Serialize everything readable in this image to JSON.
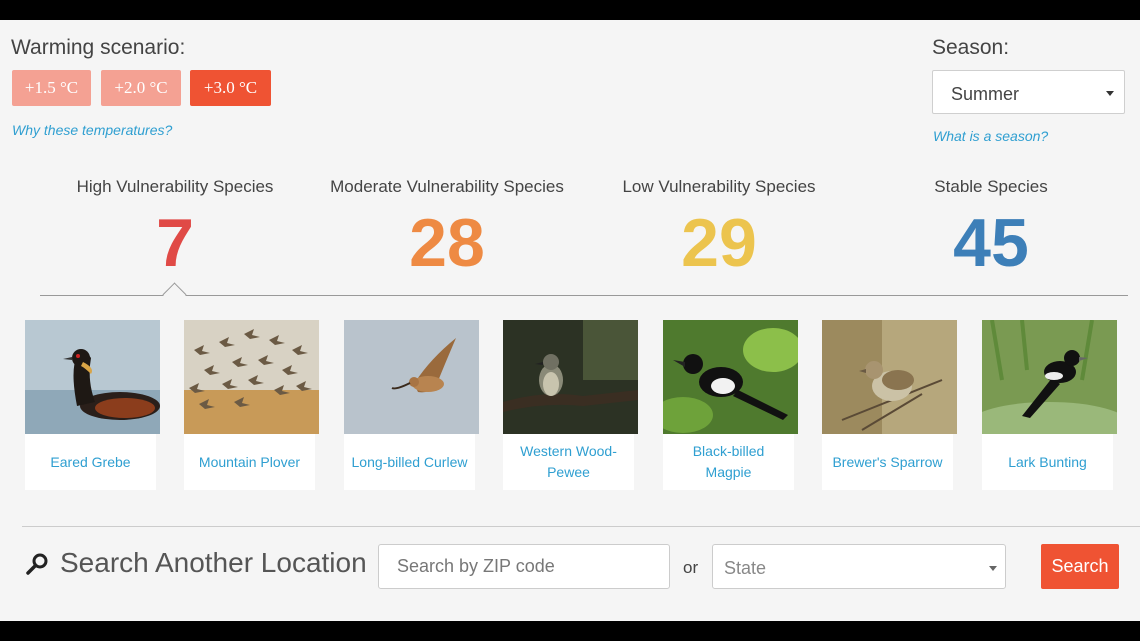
{
  "warming": {
    "label": "Warming scenario:",
    "options": [
      "+1.5 °C",
      "+2.0 °C",
      "+3.0 °C"
    ],
    "selected": "+3.0 °C",
    "why_link": "Why these temperatures?"
  },
  "season": {
    "label": "Season:",
    "selected": "Summer",
    "what_link": "What is a season?"
  },
  "stats": [
    {
      "title": "High Vulnerability Species",
      "count": "7",
      "color": "#e04a46"
    },
    {
      "title": "Moderate Vulnerability Species",
      "count": "28",
      "color": "#ee8a43"
    },
    {
      "title": "Low Vulnerability Species",
      "count": "29",
      "color": "#ecc44e"
    },
    {
      "title": "Stable Species",
      "count": "45",
      "color": "#3d7fb8"
    }
  ],
  "species": [
    {
      "name": "Eared Grebe",
      "icon": "grebe-photo"
    },
    {
      "name": "Mountain Plover",
      "icon": "plover-flock-photo"
    },
    {
      "name": "Long-billed Curlew",
      "icon": "curlew-photo"
    },
    {
      "name": "Western Wood-Pewee",
      "icon": "pewee-photo"
    },
    {
      "name": "Black-billed Magpie",
      "icon": "magpie-photo"
    },
    {
      "name": "Brewer's Sparrow",
      "icon": "sparrow-photo"
    },
    {
      "name": "Lark Bunting",
      "icon": "bunting-photo"
    }
  ],
  "search": {
    "title": "Search Another Location",
    "zip_placeholder": "Search by ZIP code",
    "or": "or",
    "state_placeholder": "State",
    "button": "Search"
  }
}
